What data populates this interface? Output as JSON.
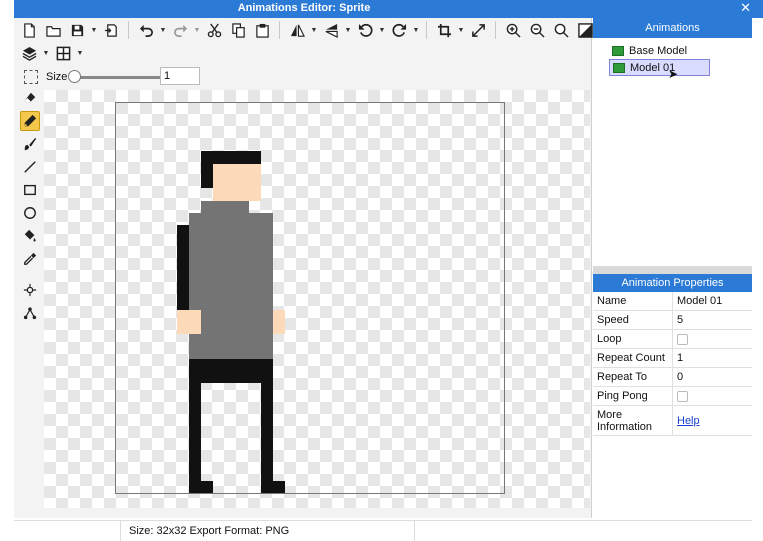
{
  "window": {
    "title": "Animations Editor: Sprite",
    "close_glyph": "✕"
  },
  "toolbar": {
    "row1_icons": [
      "new-file-icon",
      "open-folder-icon",
      "save-icon",
      "export-icon",
      "undo-icon",
      "redo-icon",
      "cut-icon",
      "copy-icon",
      "paste-icon",
      "flip-horizontal-icon",
      "flip-vertical-icon",
      "rotate-left-icon",
      "rotate-right-icon",
      "crop-icon",
      "resize-icon",
      "zoom-in-icon",
      "zoom-out-icon",
      "zoom-fit-icon",
      "background-icon"
    ],
    "row2_icons": [
      "layers-icon",
      "grid-icon"
    ]
  },
  "size_bar": {
    "label": "Size",
    "value": "1",
    "slider_fraction": 0.0
  },
  "tools": [
    "eraser-icon",
    "pencil-icon",
    "brush-icon",
    "line-icon",
    "rectangle-icon",
    "ellipse-icon",
    "fill-icon",
    "eyedropper-icon",
    "point-icon",
    "node-icon"
  ],
  "active_tool": "pencil-icon",
  "animations": {
    "header": "Animations",
    "items": [
      {
        "label": "Base Model",
        "selected": false
      },
      {
        "label": "Model 01",
        "selected": true
      }
    ]
  },
  "properties": {
    "header": "Animation Properties",
    "rows": [
      {
        "key": "Name",
        "value": "Model 01",
        "type": "text"
      },
      {
        "key": "Speed",
        "value": "5",
        "type": "text"
      },
      {
        "key": "Loop",
        "value": "",
        "type": "checkbox"
      },
      {
        "key": "Repeat Count",
        "value": "1",
        "type": "text"
      },
      {
        "key": "Repeat To",
        "value": "0",
        "type": "text"
      },
      {
        "key": "Ping Pong",
        "value": "",
        "type": "checkbox"
      },
      {
        "key": "More Information",
        "value": "Help",
        "type": "link"
      }
    ]
  },
  "status": {
    "text": "Size: 32x32   Export Format: PNG"
  },
  "colors": {
    "accent": "#2b7bd6",
    "hair": "#111111",
    "skin": "#fcd9b8",
    "shirt": "#747474",
    "pants": "#111111",
    "model_icon": "#2e9a3a"
  }
}
